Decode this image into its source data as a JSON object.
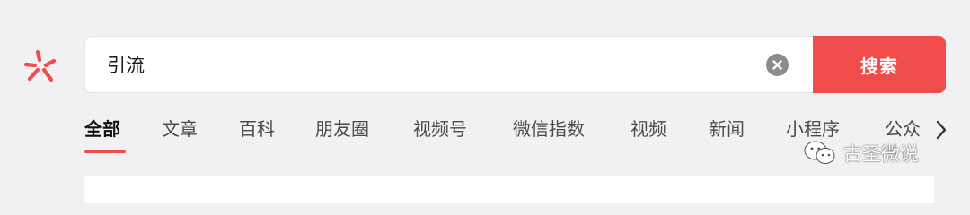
{
  "search": {
    "query": "引流",
    "button_label": "搜索"
  },
  "tabs": [
    {
      "label": "全部",
      "active": true
    },
    {
      "label": "文章"
    },
    {
      "label": "百科"
    },
    {
      "label": "朋友圈"
    },
    {
      "label": "视频号"
    },
    {
      "label": "微信指数"
    },
    {
      "label": "视频"
    },
    {
      "label": "新闻"
    },
    {
      "label": "小程序"
    },
    {
      "label": "公众"
    }
  ],
  "watermark": {
    "text": "古圣微说"
  },
  "colors": {
    "accent": "#f04c4c",
    "background": "#f1f1f3"
  },
  "icons": {
    "logo": "sogou-wechat-search-logo",
    "clear": "clear-circle-icon",
    "next": "chevron-right-icon",
    "watermark": "wechat-official-account-icon"
  }
}
